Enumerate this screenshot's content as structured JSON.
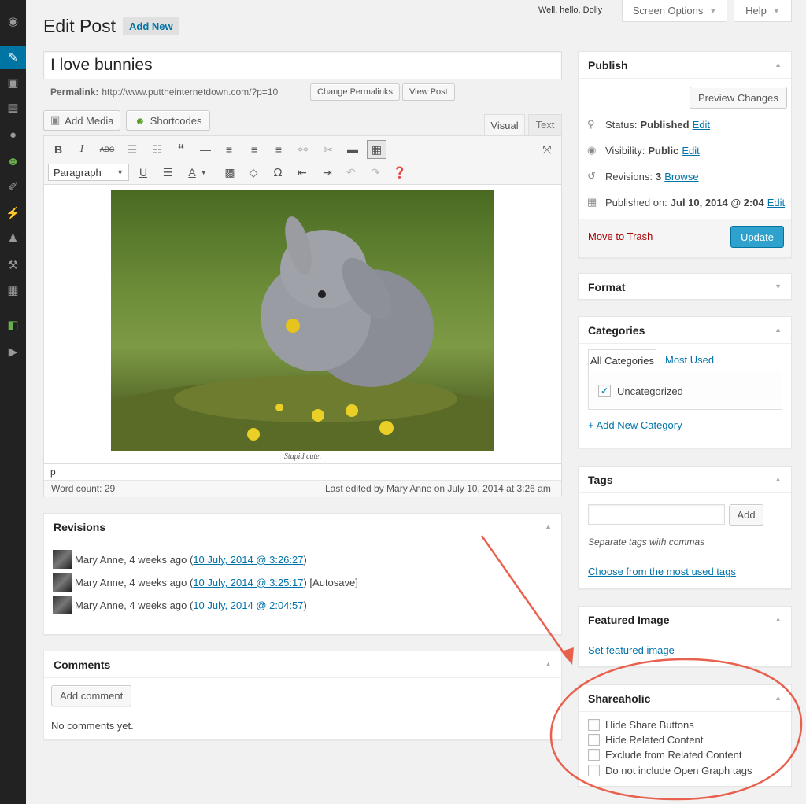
{
  "adminbar": {
    "icons": [
      "dashboard-icon",
      "posts-icon",
      "media-icon",
      "pages-icon",
      "comments-icon",
      "shortcodes-icon",
      "appearance-icon",
      "plugins-icon",
      "users-icon",
      "tools-icon",
      "settings-icon",
      "shareaholic-icon",
      "play-icon"
    ]
  },
  "header": {
    "greeting": "Well, hello, Dolly",
    "screen_options": "Screen Options",
    "help": "Help",
    "page_title": "Edit Post",
    "add_new": "Add New"
  },
  "post": {
    "title": "I love bunnies",
    "permalink_label": "Permalink:",
    "permalink_url": "http://www.puttheinternetdown.com/?p=10",
    "change_permalinks": "Change Permalinks",
    "view_post": "View Post"
  },
  "editor": {
    "add_media": "Add Media",
    "shortcodes": "Shortcodes",
    "tab_visual": "Visual",
    "tab_text": "Text",
    "format_select": "Paragraph",
    "caption": "Stupid cute.",
    "path": "p",
    "word_count": "Word count: 29",
    "last_edited": "Last edited by Mary Anne on July 10, 2014 at 3:26 am"
  },
  "revisions": {
    "title": "Revisions",
    "items": [
      {
        "author": "Mary Anne, 4 weeks ago (",
        "link": "10 July, 2014 @ 3:26:27",
        "suffix": ")"
      },
      {
        "author": "Mary Anne, 4 weeks ago (",
        "link": "10 July, 2014 @ 3:25:17",
        "suffix": ") [Autosave]"
      },
      {
        "author": "Mary Anne, 4 weeks ago (",
        "link": "10 July, 2014 @ 2:04:57",
        "suffix": ")"
      }
    ]
  },
  "comments": {
    "title": "Comments",
    "add_comment": "Add comment",
    "empty": "No comments yet."
  },
  "publish": {
    "title": "Publish",
    "preview": "Preview Changes",
    "status_label": "Status:",
    "status_value": "Published",
    "visibility_label": "Visibility:",
    "visibility_value": "Public",
    "revisions_label": "Revisions:",
    "revisions_value": "3",
    "browse": "Browse",
    "published_label": "Published on:",
    "published_value": "Jul 10, 2014 @ 2:04",
    "edit": "Edit",
    "trash": "Move to Trash",
    "update": "Update"
  },
  "format": {
    "title": "Format"
  },
  "categories": {
    "title": "Categories",
    "tab_all": "All Categories",
    "tab_most_used": "Most Used",
    "items": [
      "Uncategorized"
    ],
    "add_new": "+ Add New Category"
  },
  "tags": {
    "title": "Tags",
    "add": "Add",
    "hint": "Separate tags with commas",
    "choose": "Choose from the most used tags"
  },
  "featured_image": {
    "title": "Featured Image",
    "set": "Set featured image"
  },
  "shareaholic": {
    "title": "Shareaholic",
    "options": [
      "Hide Share Buttons",
      "Hide Related Content",
      "Exclude from Related Content",
      "Do not include Open Graph tags"
    ]
  },
  "colors": {
    "accent": "#0074a2",
    "annotation": "#e8614e",
    "trash": "#a00"
  }
}
